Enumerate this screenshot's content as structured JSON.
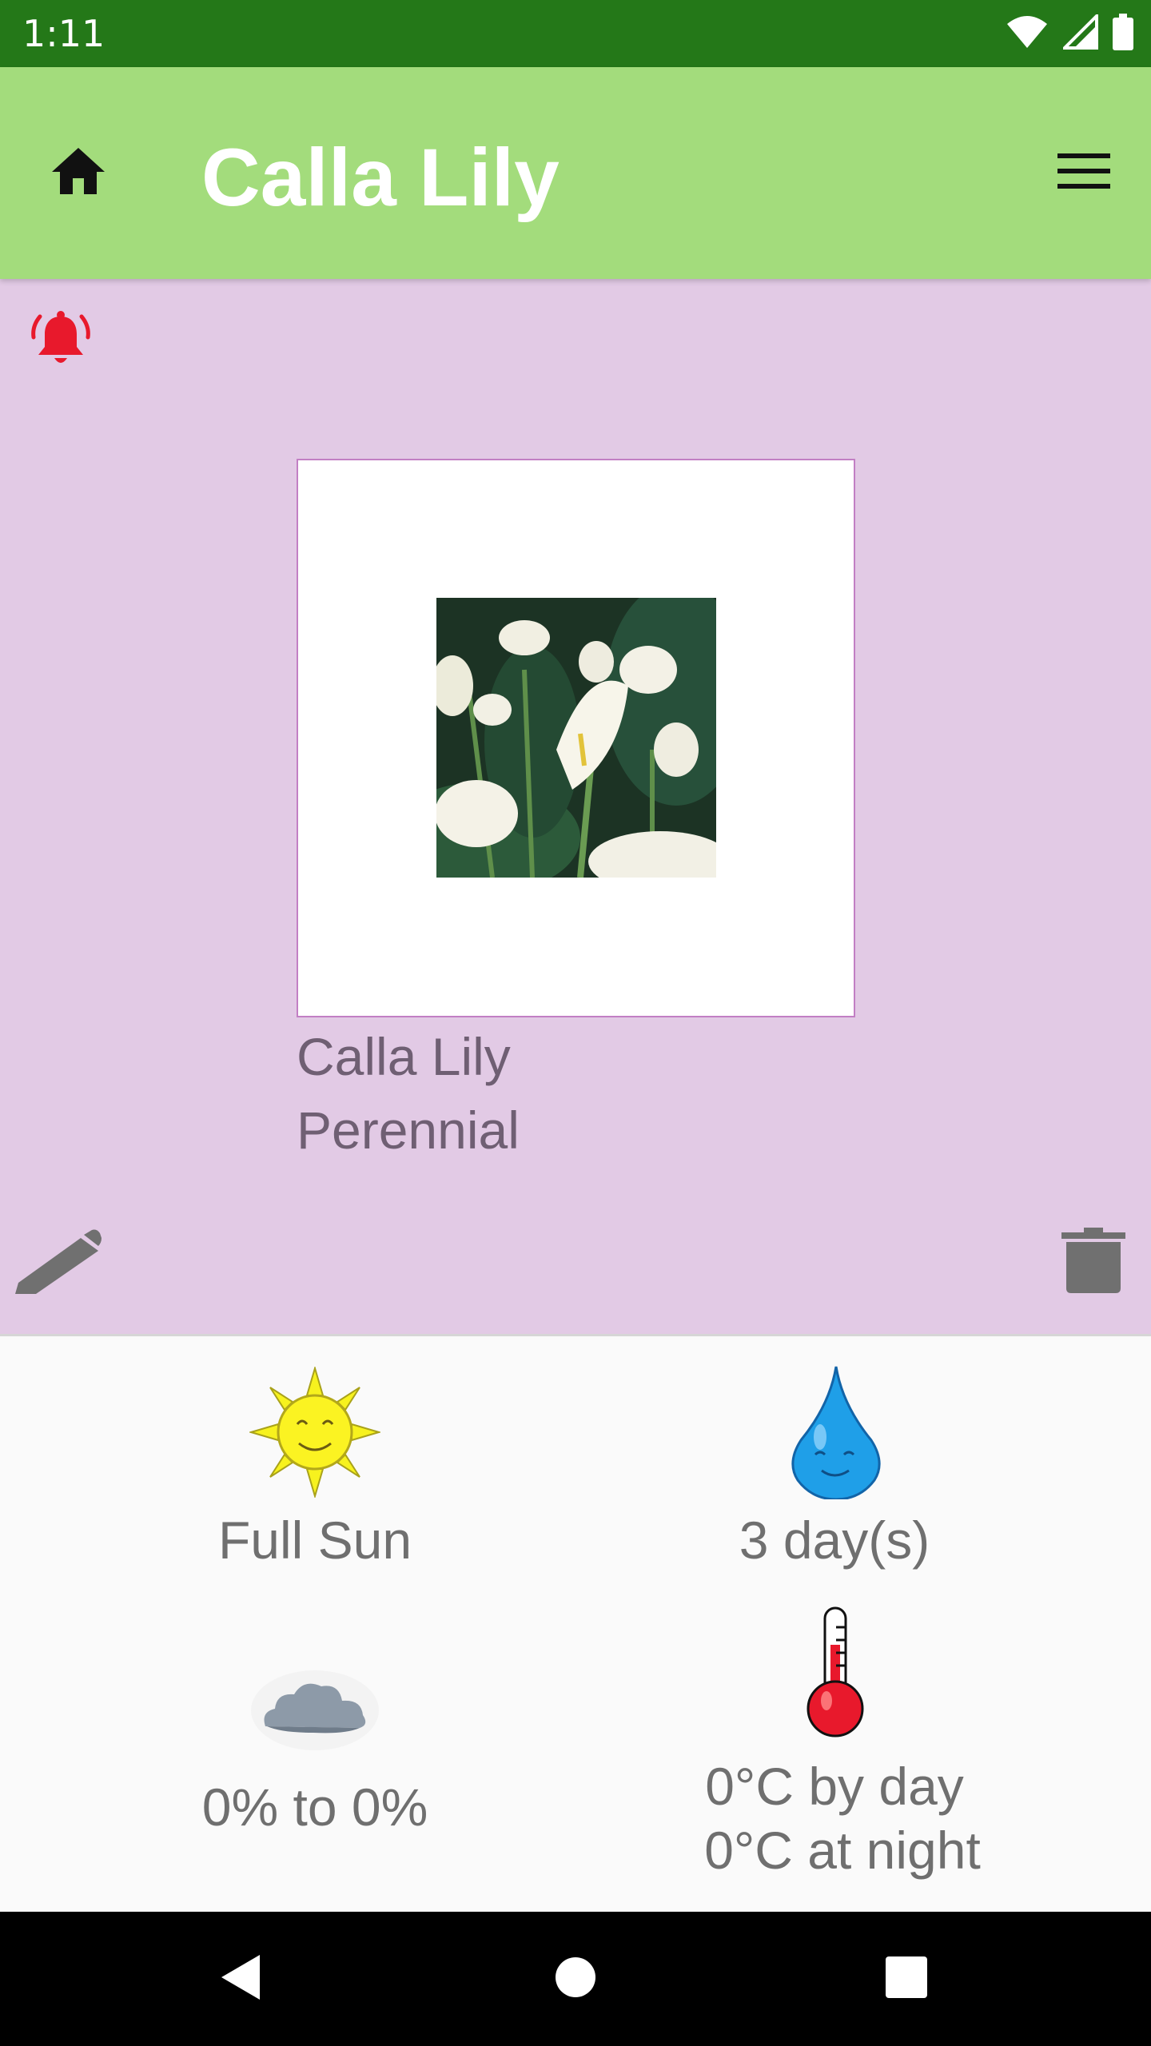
{
  "status_bar": {
    "time": "1:11",
    "icons": [
      "wifi-icon",
      "signal-icon",
      "battery-icon"
    ]
  },
  "app_bar": {
    "title": "Calla Lily",
    "home_icon": "home-icon",
    "menu_icon": "menu-icon"
  },
  "plant_card": {
    "name": "Calla Lily",
    "type": "Perennial",
    "alarm_icon": "alarm-bell-icon",
    "edit_icon": "pencil-icon",
    "delete_icon": "trash-icon"
  },
  "care": {
    "sunlight": {
      "icon": "sun-icon",
      "label": "Full Sun"
    },
    "watering": {
      "icon": "water-drop-icon",
      "label": "3 day(s)"
    },
    "humidity": {
      "icon": "cloud-icon",
      "label": "0% to 0%"
    },
    "temperature": {
      "icon": "thermometer-icon",
      "day_label": "0°C by day",
      "night_label": "0°C at night"
    }
  },
  "colors": {
    "status_bar": "#247818",
    "app_bar": "#a3dc7c",
    "card_background": "#e2cae5",
    "alarm_red": "#e8192c",
    "body_text": "#6f6f6f"
  }
}
